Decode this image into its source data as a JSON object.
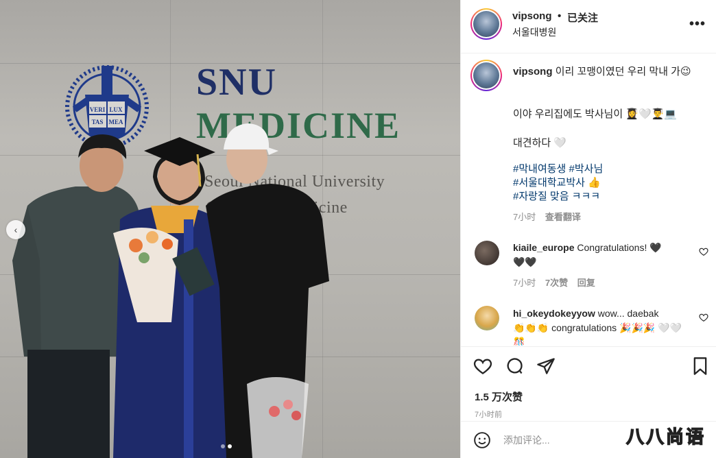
{
  "photo": {
    "sign": {
      "line1": "SNU",
      "line2": "MEDICINE",
      "line3": "Seoul National University",
      "line4": "College of Medicine"
    },
    "seal": {
      "text": [
        "VERI",
        "LUX",
        "TAS",
        "MEA"
      ]
    },
    "carousel": {
      "prev_icon": "‹",
      "dots": 2,
      "active_dot": 1
    }
  },
  "header": {
    "username": "vipsong",
    "separator": "•",
    "follow_status": "已关注",
    "location": "서울대병원",
    "more_icon": "•••"
  },
  "caption": {
    "username": "vipsong",
    "text1": "이리 꼬맹이였던 우리 막내 가😉",
    "text2": "이야 우리집에도 박사님이 👩‍🎓🤍👨‍🎓💻",
    "text3": "대견하다 🤍",
    "hashtags": [
      "#막내여동생 #박사님",
      "#서울대학교박사 👍",
      "#자랑질 맞음 ㅋㅋㅋ"
    ],
    "time": "7小时",
    "translate": "查看翻译"
  },
  "comments": [
    {
      "username": "kiaile_europe",
      "text_line1": "Congratulations! 🖤",
      "text_line2": "🖤🖤",
      "time": "7小时",
      "likes": "7次赞",
      "reply": "回复"
    },
    {
      "username": "hi_okeydokeyyow",
      "text_line1": "wow... daebak",
      "text_line2": "👏👏👏 congratulations 🎉🎉🎉 🤍🤍",
      "text_line3": "🎊"
    }
  ],
  "actions": {
    "like_icon": "heart-icon",
    "comment_icon": "comment-icon",
    "share_icon": "share-icon",
    "save_icon": "bookmark-icon",
    "likes_count": "1.5 万次赞",
    "time_ago": "7小时前"
  },
  "add_comment": {
    "placeholder": "添加评论...",
    "emoji_icon": "emoji-icon"
  },
  "watermark": "八八尚语",
  "colors": {
    "accent_link": "#00376b",
    "meta_gray": "#8e8e8e",
    "sign_navy": "#1f2f66",
    "sign_green": "#2f6a49"
  }
}
